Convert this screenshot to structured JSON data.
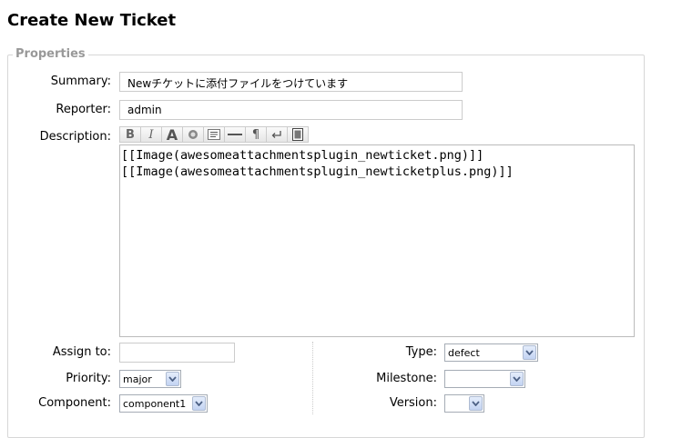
{
  "page": {
    "title": "Create New Ticket"
  },
  "properties": {
    "legend": "Properties",
    "summary": {
      "label": "Summary:",
      "value": "Newチケットに添付ファイルをつけています"
    },
    "reporter": {
      "label": "Reporter:",
      "value": "admin"
    },
    "description": {
      "label": "Description:",
      "toolbar": [
        {
          "name": "bold",
          "glyph": "B"
        },
        {
          "name": "italic",
          "glyph": "I"
        },
        {
          "name": "heading",
          "glyph": "A"
        },
        {
          "name": "link",
          "glyph": "link"
        },
        {
          "name": "code-block",
          "glyph": "code"
        },
        {
          "name": "horizontal-rule",
          "glyph": "hr"
        },
        {
          "name": "paragraph",
          "glyph": "¶"
        },
        {
          "name": "line-break",
          "glyph": "br"
        },
        {
          "name": "image",
          "glyph": "img"
        }
      ],
      "text": "[[Image(awesomeattachmentsplugin_newticket.png)]]\n[[Image(awesomeattachmentsplugin_newticketplus.png)]]"
    },
    "assign_to": {
      "label": "Assign to:",
      "value": ""
    },
    "type": {
      "label": "Type:",
      "value": "defect"
    },
    "priority": {
      "label": "Priority:",
      "value": "major"
    },
    "milestone": {
      "label": "Milestone:",
      "value": ""
    },
    "component": {
      "label": "Component:",
      "value": "component1"
    },
    "version": {
      "label": "Version:",
      "value": ""
    }
  }
}
